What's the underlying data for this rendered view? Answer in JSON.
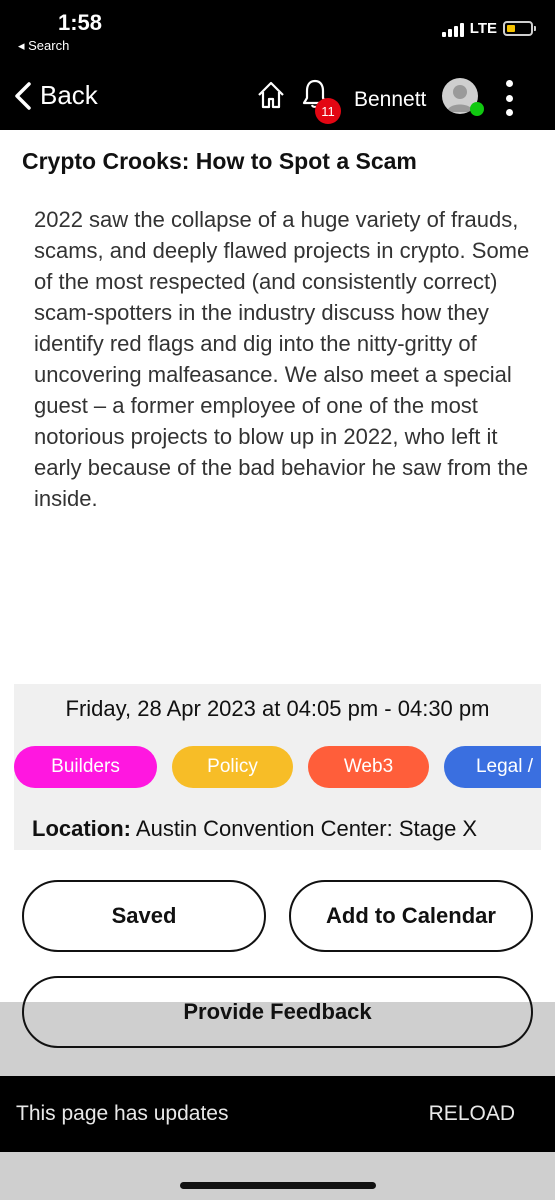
{
  "status_bar": {
    "time": "1:58",
    "back_app": "◂ Search",
    "network": "LTE",
    "battery_level": 0.35,
    "battery_color": "#f5c200"
  },
  "nav": {
    "back_label": "Back",
    "back_icon": "chevron-left-icon",
    "home_icon": "home-icon",
    "bell_icon": "bell-icon",
    "notification_count": "11",
    "user_name": "Bennett",
    "avatar_icon": "user-avatar-icon",
    "online_color": "#10c810",
    "more_icon": "more-vertical-icon"
  },
  "session": {
    "title": "Crypto Crooks: How to Spot a Scam",
    "description": "2022 saw the collapse of a huge variety of frauds, scams, and deeply flawed projects in crypto. Some of the most respected (and consistently correct) scam-spotters in the industry discuss how they identify red flags and dig into the nitty-gritty of uncovering malfeasance. We also meet a special guest – a former employee of one of the most notorious projects to blow up in 2022, who left it early because of the bad behavior he saw from the inside.",
    "datetime": "Friday, 28 Apr 2023 at 04:05 pm - 04:30 pm",
    "tags": [
      {
        "label": "Builders",
        "color": "#ff17e0"
      },
      {
        "label": "Policy",
        "color": "#f7bd27"
      },
      {
        "label": "Web3",
        "color": "#ff5e3a"
      },
      {
        "label": "Legal /",
        "color": "#3a6fe0"
      }
    ],
    "location_label": "Location:",
    "location_value": "Austin Convention Center: Stage X"
  },
  "actions": {
    "saved_label": "Saved",
    "calendar_label": "Add to Calendar",
    "feedback_label": "Provide Feedback"
  },
  "snackbar": {
    "message": "This page has updates",
    "action": "RELOAD"
  }
}
